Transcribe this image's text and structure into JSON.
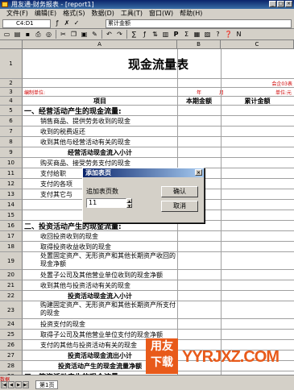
{
  "window": {
    "title": "用友通-财务报表 - [report1]"
  },
  "menu": [
    "文件(F)",
    "编辑(E)",
    "格式(S)",
    "数据(D)",
    "工具(T)",
    "窗口(W)",
    "帮助(H)"
  ],
  "editbar": {
    "cell_ref": "C4:D1",
    "formula": "累计金额"
  },
  "toolbar": [
    "new-icon",
    "open-icon",
    "save-icon",
    "print-icon",
    "preview-icon",
    "cut-icon",
    "copy-icon",
    "paste-icon",
    "format-painter-icon",
    "undo-icon",
    "redo-icon",
    "sum-icon",
    "fx-icon",
    "sort-icon",
    "chart-icon",
    "P",
    "Σ",
    "fill-icon",
    "merge-icon",
    "query-icon",
    "help-icon",
    "n-icon"
  ],
  "columns": [
    "A",
    "B",
    "C"
  ],
  "title": "现金流量表",
  "meta": {
    "code": "会企03表",
    "unit_label": "编制单位:",
    "year": "年",
    "month": "月",
    "currency": "单位:元"
  },
  "headers": {
    "item": "项目",
    "current": "本期金额",
    "cumulative": "累计金额"
  },
  "rows": [
    {
      "n": "5",
      "text": "一、经营活动产生的现金流量:",
      "style": "section"
    },
    {
      "n": "6",
      "text": "销售商品、提供劳务收到的现金",
      "style": "item"
    },
    {
      "n": "7",
      "text": "收到的税费返还",
      "style": "item"
    },
    {
      "n": "8",
      "text": "收到其他与经营活动有关的现金",
      "style": "item"
    },
    {
      "n": "9",
      "text": "经营活动现金流入小计",
      "style": "subtotal"
    },
    {
      "n": "10",
      "text": "购买商品、接受劳务支付的现金",
      "style": "item"
    },
    {
      "n": "11",
      "text": "支付给职",
      "style": "item"
    },
    {
      "n": "12",
      "text": "支付的各项",
      "style": "item"
    },
    {
      "n": "13",
      "text": "支付其它与",
      "style": "item"
    },
    {
      "n": "14",
      "text": "经营活",
      "style": "subtotal"
    },
    {
      "n": "15",
      "text": "经营活动",
      "style": "subtotal"
    },
    {
      "n": "16",
      "text": "二、投资活动产生的现金流量:",
      "style": "section"
    },
    {
      "n": "17",
      "text": "收回投资收到的现金",
      "style": "item"
    },
    {
      "n": "18",
      "text": "取得投资收益收到的现金",
      "style": "item"
    },
    {
      "n": "19",
      "text": "处置固定资产、无形资产和其他长期资产收回的现金净额",
      "style": "wrap"
    },
    {
      "n": "20",
      "text": "处置子公司及其他营业单位收到的现金净额",
      "style": "item"
    },
    {
      "n": "21",
      "text": "收到其他与投资活动有关的现金",
      "style": "item"
    },
    {
      "n": "22",
      "text": "投资活动现金流入小计",
      "style": "subtotal"
    },
    {
      "n": "23",
      "text": "购建固定资产、无形资产和其他长期资产所支付的现金",
      "style": "wrap"
    },
    {
      "n": "24",
      "text": "投资支付的现金",
      "style": "item"
    },
    {
      "n": "25",
      "text": "取得子公司及其他营业单位支付的现金净额",
      "style": "item"
    },
    {
      "n": "26",
      "text": "支付的其他与投资活动有关的现金",
      "style": "item"
    },
    {
      "n": "27",
      "text": "投资活动现金流出小计",
      "style": "subtotal"
    },
    {
      "n": "28",
      "text": "投资活动产生的现金流量净额",
      "style": "subtotal"
    },
    {
      "n": "29",
      "text": "三、筹资活动产生的现金流量:",
      "style": "section"
    }
  ],
  "dialog": {
    "title": "添加表页",
    "label": "追加表页数",
    "value": "11",
    "ok": "确认",
    "cancel": "取消"
  },
  "status": {
    "mode": "数据",
    "sheet_tab": "第1页"
  },
  "watermark": {
    "badge": "用友下载",
    "text": "YYRJXZ.COM"
  }
}
